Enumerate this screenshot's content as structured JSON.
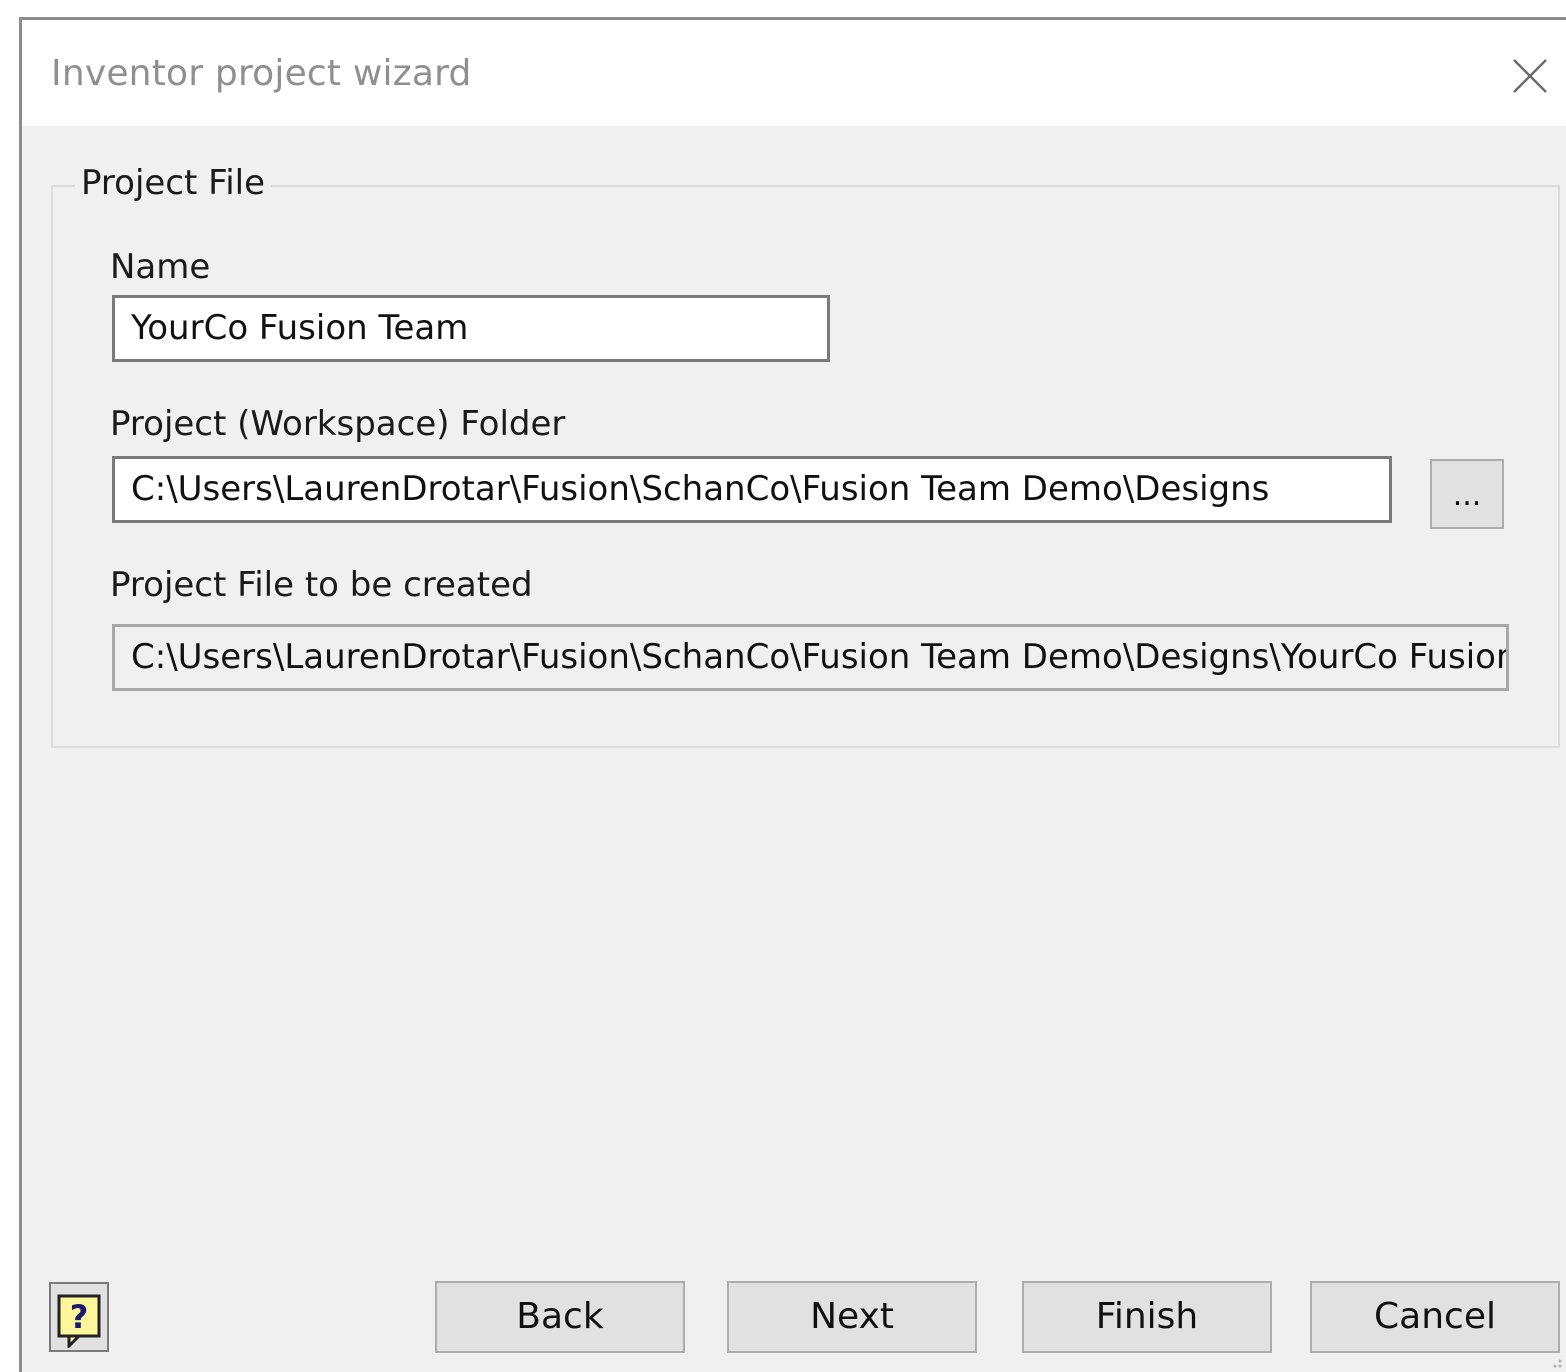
{
  "window": {
    "title": "Inventor project wizard",
    "close_icon": "close-icon"
  },
  "project_file": {
    "group_label": "Project File",
    "name_label": "Name",
    "name_value": "YourCo Fusion Team",
    "folder_label": "Project (Workspace) Folder",
    "folder_value": "C:\\Users\\LaurenDrotar\\Fusion\\SchanCo\\Fusion Team Demo\\Designs",
    "browse_label": "...",
    "created_label": "Project File to be created",
    "created_value": "C:\\Users\\LaurenDrotar\\Fusion\\SchanCo\\Fusion Team Demo\\Designs\\YourCo Fusion"
  },
  "footer": {
    "help_icon": "help-icon",
    "back_label": "Back",
    "next_label": "Next",
    "finish_label": "Finish",
    "cancel_label": "Cancel"
  }
}
